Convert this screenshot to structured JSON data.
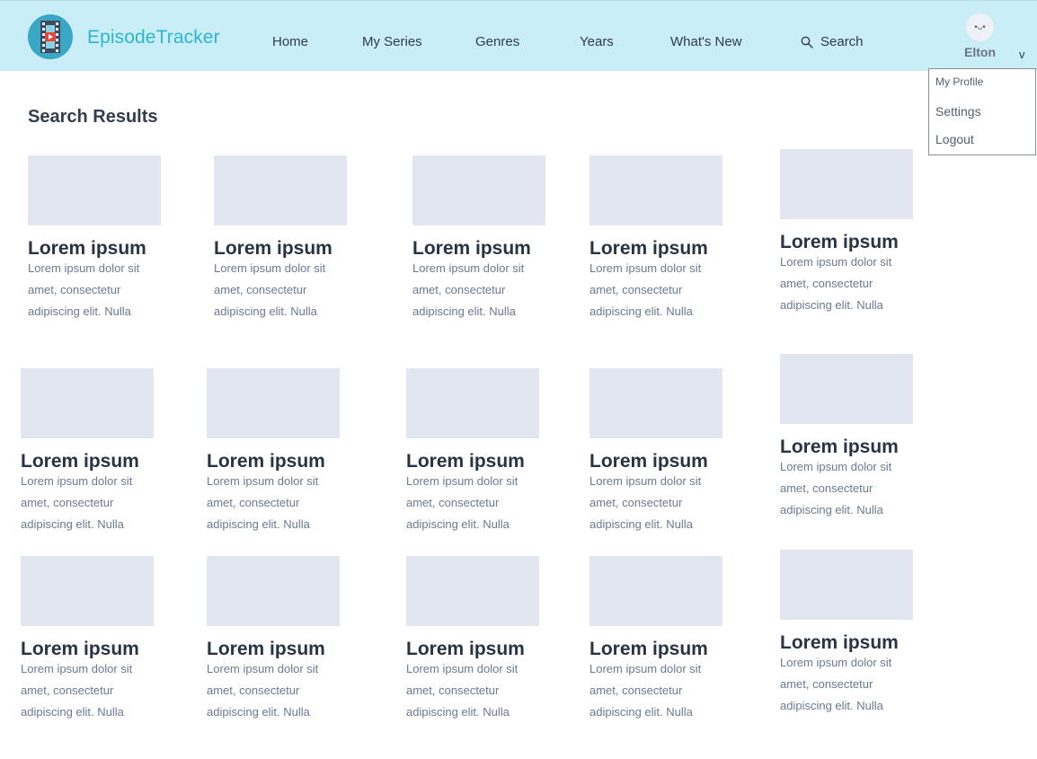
{
  "header": {
    "brand": "EpisodeTracker",
    "nav": [
      {
        "label": "Home"
      },
      {
        "label": "My Series"
      },
      {
        "label": "Genres"
      },
      {
        "label": "Years"
      },
      {
        "label": "What's New"
      }
    ],
    "search_label": "Search",
    "user": {
      "avatar_face": "•ᴗ•",
      "name": "Elton",
      "chevron": "v"
    },
    "menu": {
      "profile": "My Profile",
      "settings": "Settings",
      "logout": "Logout"
    }
  },
  "main": {
    "title": "Search Results",
    "cards": [
      {
        "title": "Lorem ipsum",
        "desc": "Lorem ipsum dolor sit amet, consectetur adipiscing elit. Nulla"
      },
      {
        "title": "Lorem ipsum",
        "desc": "Lorem ipsum dolor sit amet, consectetur adipiscing elit. Nulla"
      },
      {
        "title": "Lorem ipsum",
        "desc": "Lorem ipsum dolor sit amet, consectetur adipiscing elit. Nulla"
      },
      {
        "title": "Lorem ipsum",
        "desc": "Lorem ipsum dolor sit amet, consectetur adipiscing elit. Nulla"
      },
      {
        "title": "Lorem ipsum",
        "desc": "Lorem ipsum dolor sit amet, consectetur adipiscing elit. Nulla"
      },
      {
        "title": "Lorem ipsum",
        "desc": "Lorem ipsum dolor sit amet, consectetur adipiscing elit. Nulla"
      },
      {
        "title": "Lorem ipsum",
        "desc": "Lorem ipsum dolor sit amet, consectetur adipiscing elit. Nulla"
      },
      {
        "title": "Lorem ipsum",
        "desc": "Lorem ipsum dolor sit amet, consectetur adipiscing elit. Nulla"
      },
      {
        "title": "Lorem ipsum",
        "desc": "Lorem ipsum dolor sit amet, consectetur adipiscing elit. Nulla"
      },
      {
        "title": "Lorem ipsum",
        "desc": "Lorem ipsum dolor sit amet, consectetur adipiscing elit. Nulla"
      },
      {
        "title": "Lorem ipsum",
        "desc": "Lorem ipsum dolor sit amet, consectetur adipiscing elit. Nulla"
      },
      {
        "title": "Lorem ipsum",
        "desc": "Lorem ipsum dolor sit amet, consectetur adipiscing elit. Nulla"
      },
      {
        "title": "Lorem ipsum",
        "desc": "Lorem ipsum dolor sit amet, consectetur adipiscing elit. Nulla"
      },
      {
        "title": "Lorem ipsum",
        "desc": "Lorem ipsum dolor sit amet, consectetur adipiscing elit. Nulla"
      },
      {
        "title": "Lorem ipsum",
        "desc": "Lorem ipsum dolor sit amet, consectetur adipiscing elit. Nulla"
      }
    ]
  },
  "icons": {
    "logo": "film-play-icon",
    "search": "search-icon",
    "chevron": "chevron-down-icon"
  },
  "colors": {
    "header_bg": "#c9eef7",
    "brand": "#2db5d0",
    "thumb_placeholder": "#e1e6f0"
  }
}
